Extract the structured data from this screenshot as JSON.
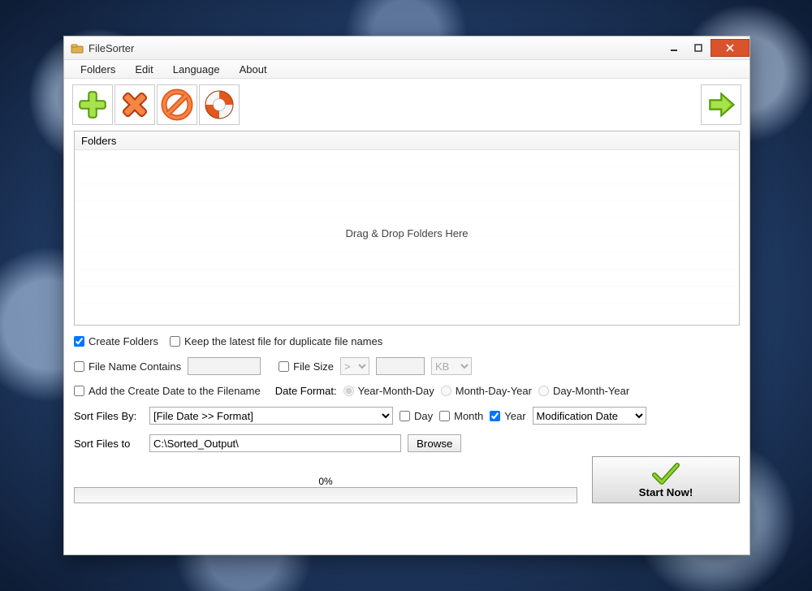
{
  "title": "FileSorter",
  "menu": {
    "folders": "Folders",
    "edit": "Edit",
    "language": "Language",
    "about": "About"
  },
  "folders_panel": {
    "header": "Folders",
    "hint": "Drag & Drop Folders Here"
  },
  "opts": {
    "create_folders": "Create Folders",
    "keep_latest": "Keep the latest file for duplicate file names",
    "filename_contains": "File Name Contains",
    "file_size": "File Size",
    "size_op": ">",
    "size_unit": "KB",
    "add_create_date": "Add the Create Date to the Filename",
    "date_format_label": "Date Format:",
    "fmt_ymd": "Year-Month-Day",
    "fmt_mdy": "Month-Day-Year",
    "fmt_dmy": "Day-Month-Year"
  },
  "sort": {
    "label": "Sort Files By:",
    "value": "[File Date >> Format]",
    "day": "Day",
    "month": "Month",
    "year": "Year",
    "date_type": "Modification Date"
  },
  "dest": {
    "label": "Sort Files to",
    "path": "C:\\Sorted_Output\\",
    "browse": "Browse"
  },
  "progress": {
    "pct": "0%"
  },
  "start_label": "Start Now!"
}
